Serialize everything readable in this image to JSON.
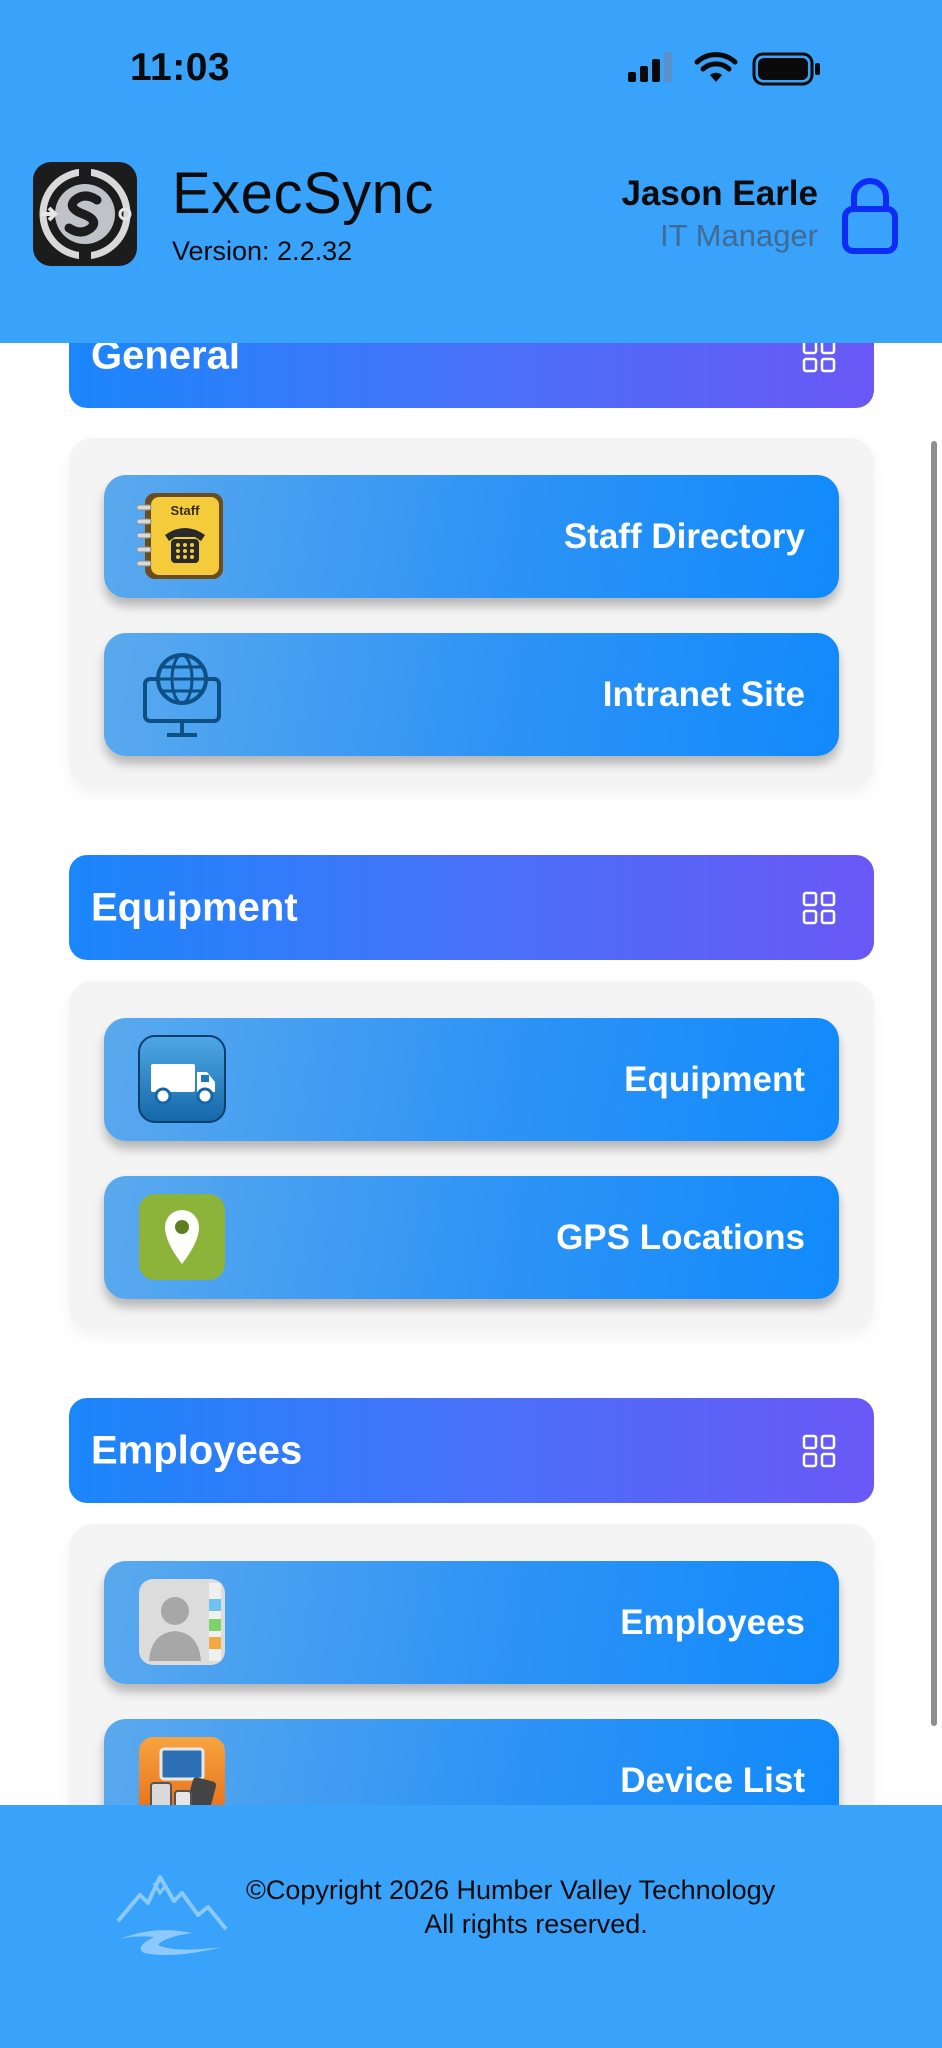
{
  "status_bar": {
    "time": "11:03",
    "battery_level": 1.0
  },
  "header": {
    "app_name": "ExecSync",
    "version": "Version: 2.2.32",
    "user_name": "Jason Earle",
    "user_role": "IT Manager",
    "lock_icon": "lock-icon"
  },
  "sections": [
    {
      "title": "General",
      "tiles": [
        {
          "label": "Staff Directory",
          "icon": "staff-phonebook-icon",
          "icon_text": "Staff"
        },
        {
          "label": "Intranet Site",
          "icon": "globe-monitor-icon"
        }
      ]
    },
    {
      "title": "Equipment",
      "tiles": [
        {
          "label": "Equipment",
          "icon": "truck-icon"
        },
        {
          "label": "GPS Locations",
          "icon": "map-pin-icon"
        }
      ]
    },
    {
      "title": "Employees",
      "tiles": [
        {
          "label": "Employees",
          "icon": "contacts-icon"
        },
        {
          "label": "Device List",
          "icon": "devices-icon"
        }
      ]
    }
  ],
  "footer": {
    "copyright": "©Copyright 2026 Humber Valley Technology",
    "rights": "All rights reserved."
  },
  "colors": {
    "header_bg": "#39a2fb",
    "section_gradient_start": "#1b86fb",
    "section_gradient_end": "#6a58f6",
    "tile_blue": "#118afc",
    "lock_blue": "#0d2df5"
  }
}
